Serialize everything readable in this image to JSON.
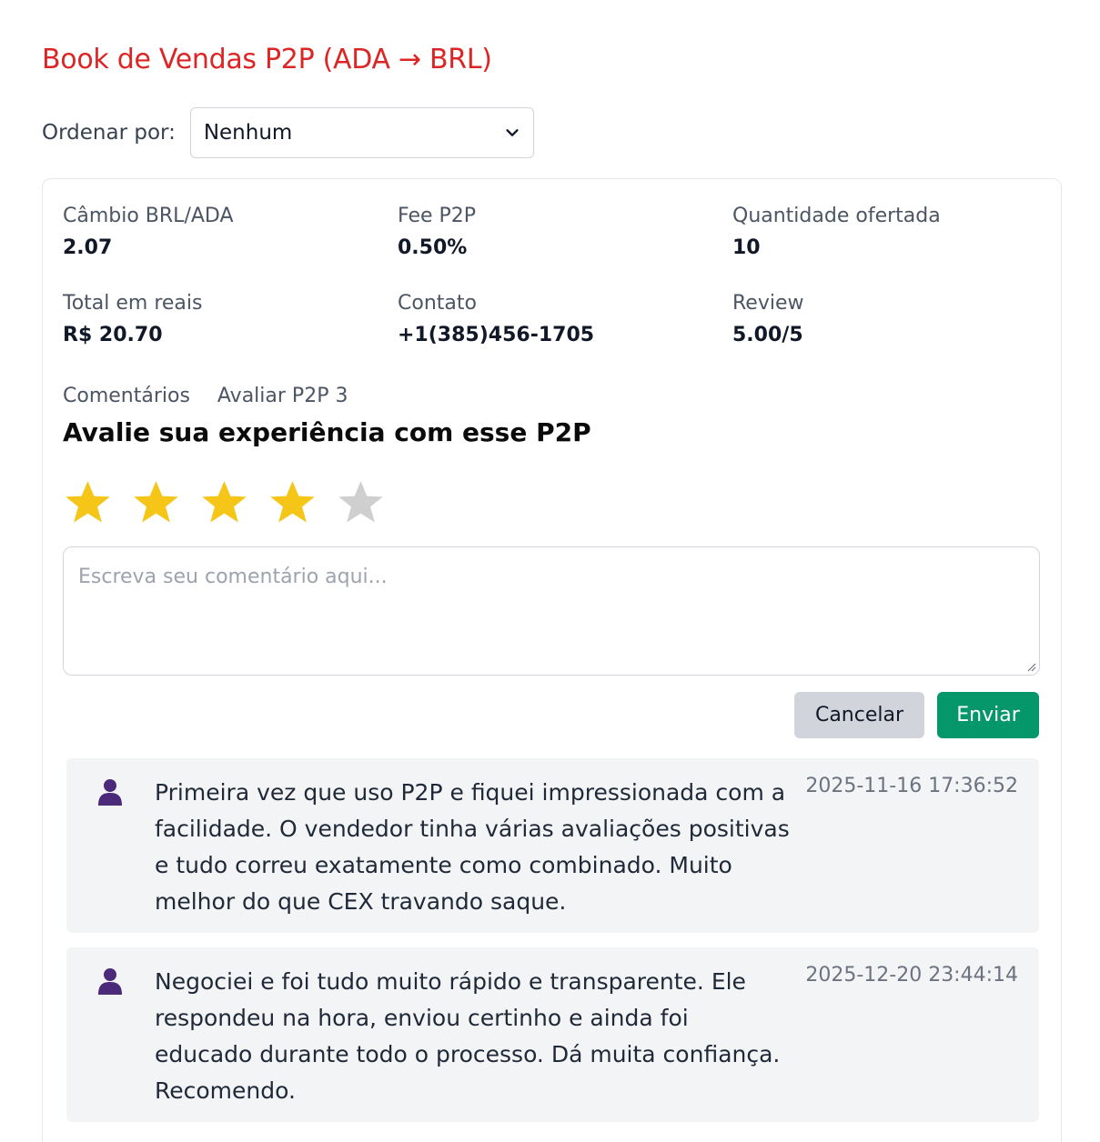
{
  "page": {
    "title": "Book de Vendas P2P (ADA → BRL)"
  },
  "sort": {
    "label": "Ordenar por:",
    "selected": "Nenhum"
  },
  "stats": [
    {
      "label": "Câmbio BRL/ADA",
      "value": "2.07"
    },
    {
      "label": "Fee P2P",
      "value": "0.50%"
    },
    {
      "label": "Quantidade ofertada",
      "value": "10"
    },
    {
      "label": "Total em reais",
      "value": "R$ 20.70"
    },
    {
      "label": "Contato",
      "value": "+1(385)456-1705"
    },
    {
      "label": "Review",
      "value": "5.00/5"
    }
  ],
  "tabs": {
    "comments": "Comentários",
    "rate": "Avaliar P2P 3"
  },
  "rating": {
    "heading": "Avalie sua experiência com esse P2P",
    "selected": 4,
    "max": 5,
    "filled_color": "#f5c518",
    "empty_color": "#cfcfcf"
  },
  "comment_form": {
    "placeholder": "Escreva seu comentário aqui...",
    "cancel_label": "Cancelar",
    "send_label": "Enviar"
  },
  "comments": [
    {
      "icon": "user-icon",
      "text": "Primeira vez que uso P2P e fiquei impressionada com a facilidade. O vendedor tinha várias avaliações positivas e tudo correu exatamente como combinado. Muito melhor do que CEX travando saque.",
      "timestamp": "2025-11-16 17:36:52"
    },
    {
      "icon": "user-icon",
      "text": "Negociei e foi tudo muito rápido e transparente. Ele respondeu na hora, enviou certinho e ainda foi educado durante todo o processo. Dá muita confiança. Recomendo.",
      "timestamp": "2025-12-20 23:44:14"
    }
  ],
  "colors": {
    "title": "#dc2626",
    "send_button": "#059669",
    "cancel_button": "#d1d5db",
    "user_icon": "#4c2a7a"
  }
}
